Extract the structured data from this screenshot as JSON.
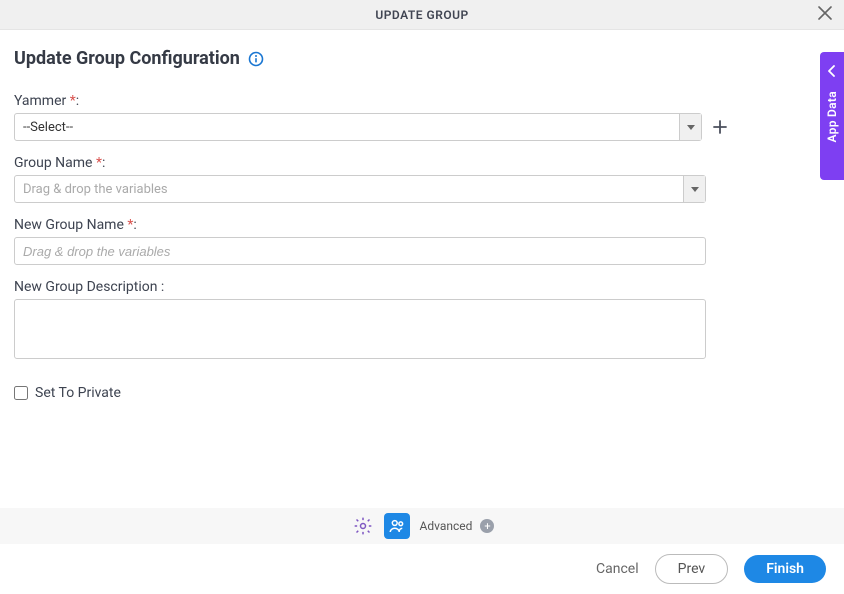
{
  "header": {
    "title": "UPDATE GROUP"
  },
  "page": {
    "title": "Update Group Configuration"
  },
  "form": {
    "yammer": {
      "label": "Yammer",
      "selected": "--Select--"
    },
    "groupName": {
      "label": "Group Name",
      "placeholder": "Drag & drop the variables"
    },
    "newGroupName": {
      "label": "New Group Name",
      "placeholder": "Drag & drop the variables",
      "value": ""
    },
    "newGroupDesc": {
      "label": "New Group Description :",
      "value": ""
    },
    "setPrivate": {
      "label": "Set To Private",
      "checked": false
    }
  },
  "toolbar": {
    "advanced": "Advanced"
  },
  "footer": {
    "cancel": "Cancel",
    "prev": "Prev",
    "finish": "Finish"
  },
  "sideTab": {
    "label": "App Data"
  }
}
